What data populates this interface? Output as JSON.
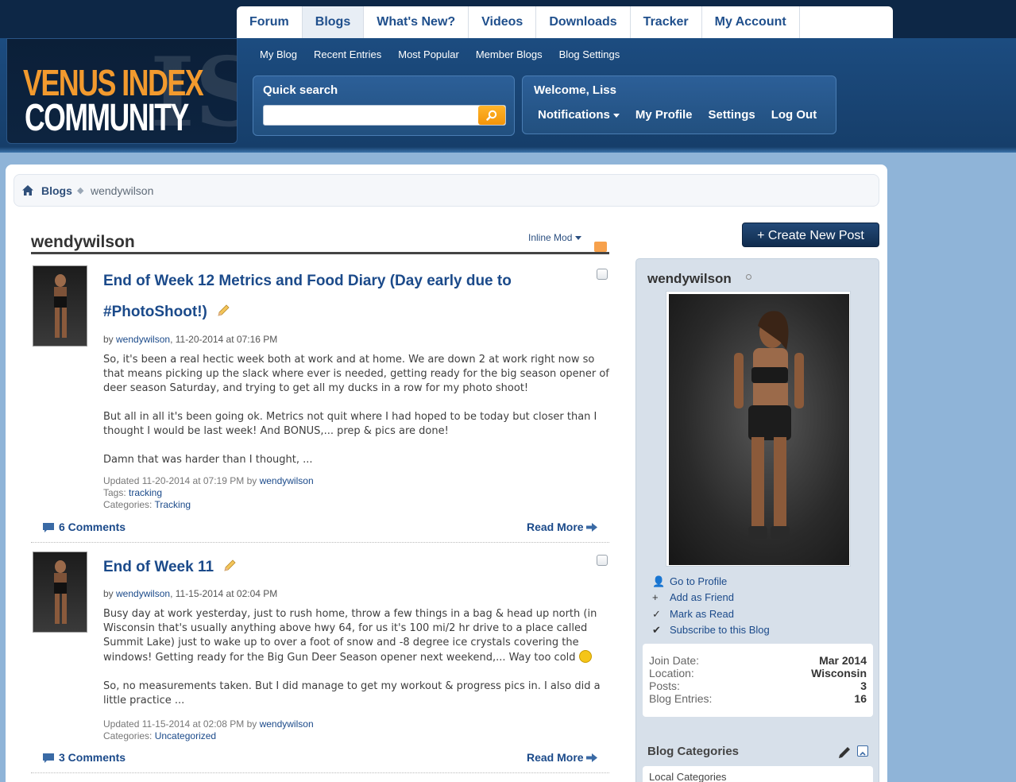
{
  "header": {
    "logo": {
      "line1": "VENUS INDEX",
      "line2": "COMMUNITY",
      "watermark": "IS"
    },
    "main_tabs": [
      {
        "label": "Forum"
      },
      {
        "label": "Blogs",
        "active": true
      },
      {
        "label": "What's New?"
      },
      {
        "label": "Videos"
      },
      {
        "label": "Downloads"
      },
      {
        "label": "Tracker"
      },
      {
        "label": "My Account"
      }
    ],
    "sub_tabs": [
      {
        "label": "My Blog"
      },
      {
        "label": "Recent Entries"
      },
      {
        "label": "Most Popular"
      },
      {
        "label": "Member Blogs"
      },
      {
        "label": "Blog Settings"
      }
    ],
    "quick_search": {
      "label": "Quick search",
      "value": "",
      "placeholder": ""
    },
    "welcome": {
      "text": "Welcome, Liss",
      "links": {
        "notifications": "Notifications",
        "profile": "My Profile",
        "settings": "Settings",
        "logout": "Log Out"
      }
    }
  },
  "breadcrumb": {
    "parent": "Blogs",
    "current": "wendywilson"
  },
  "blog": {
    "title": "wendywilson",
    "inline_mod": "Inline Mod",
    "entries": [
      {
        "title_line1": "End of Week 12 Metrics and Food Diary (Day early due to",
        "title_line2": "#PhotoShoot!)",
        "meta_prefix": "by ",
        "author": "wendywilson",
        "date": ", 11-20-2014 at 07:16 PM",
        "paragraphs": [
          "So, it's been a real hectic week both at work and at home. We are down 2 at work right now so that means picking up the slack where ever is needed, getting ready for the big season opener of deer season Saturday, and trying to get all my ducks in a row for my photo shoot!",
          "But all in all it's been going ok. Metrics not quit where I had hoped to be today but closer than I thought I would be last week! And BONUS,... prep & pics are done!",
          "Damn that was harder than I thought, ..."
        ],
        "updated": "Updated 11-20-2014 at 07:19 PM by ",
        "updated_by": "wendywilson",
        "tags_label": "Tags: ",
        "tags": "tracking",
        "categories_label": "Categories: ",
        "categories": "Tracking",
        "comments": "6 Comments",
        "read_more": "Read More"
      },
      {
        "title_line1": "End of Week 11",
        "meta_prefix": "by ",
        "author": "wendywilson",
        "date": ", 11-15-2014 at 02:04 PM",
        "paragraphs": [
          "Busy day at work yesterday, just to rush home, throw a few things in a bag & head up north (in Wisconsin that's usually anything above hwy 64, for us it's 100 mi/2 hr drive to a place called Summit Lake) just to wake up to over a foot of snow and -8 degree ice crystals covering the windows! Getting ready for the Big Gun Deer Season opener next weekend,... Way too cold",
          "So, no measurements taken. But I did manage to get my workout & progress pics in. I also did a little practice ..."
        ],
        "updated": "Updated 11-15-2014 at 02:08 PM by ",
        "updated_by": "wendywilson",
        "categories_label": "Categories: ",
        "categories": "Uncategorized",
        "comments": "3 Comments",
        "read_more": "Read More"
      }
    ]
  },
  "sidebar": {
    "create_post": "Create New Post",
    "username": "wendywilson",
    "actions": [
      {
        "label": "Go to Profile",
        "icon": "user-icon"
      },
      {
        "label": "Add as Friend",
        "icon": "plus-icon"
      },
      {
        "label": "Mark as Read",
        "icon": "check-icon"
      },
      {
        "label": "Subscribe to this Blog",
        "icon": "check-circle-icon"
      }
    ],
    "stats": [
      {
        "label": "Join Date:",
        "value": "Mar 2014"
      },
      {
        "label": "Location:",
        "value": "Wisconsin"
      },
      {
        "label": "Posts:",
        "value": "3"
      },
      {
        "label": "Blog Entries:",
        "value": "16"
      }
    ],
    "categories_title": "Blog Categories",
    "categories_local": "Local Categories"
  },
  "colors": {
    "link": "#1b4a8a",
    "header_bg": "#163e6a",
    "logo_orange": "#f29a2e",
    "search_button": "#f39409"
  }
}
